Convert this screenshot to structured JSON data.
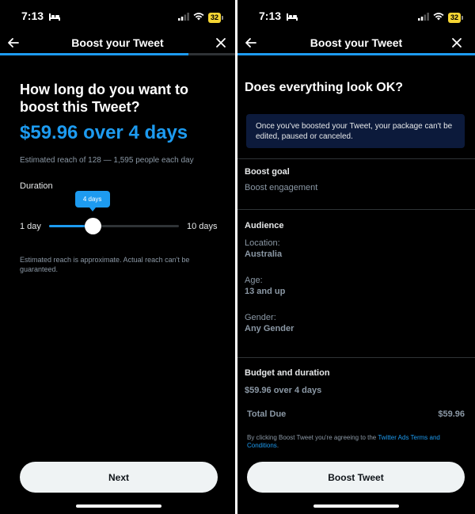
{
  "status_bar": {
    "time": "7:13",
    "battery": "32"
  },
  "left": {
    "nav_title": "Boost your Tweet",
    "question": "How long do you want to boost this Tweet?",
    "price": "$59.96 over 4 days",
    "estimated_reach": "Estimated reach of 128 — 1,595 people each day",
    "duration_label": "Duration",
    "slider": {
      "min_label": "1 day",
      "max_label": "10 days",
      "tooltip": "4 days",
      "value": 4,
      "min": 1,
      "max": 10
    },
    "disclaimer": "Estimated reach is approximate. Actual reach can't be guaranteed.",
    "next_label": "Next",
    "progress": 0.8
  },
  "right": {
    "nav_title": "Boost your Tweet",
    "heading": "Does everything look OK?",
    "warning": "Once you've boosted your Tweet, your package can't be edited, paused or canceled.",
    "boost_goal": {
      "title": "Boost goal",
      "value": "Boost engagement"
    },
    "audience": {
      "title": "Audience",
      "location_label": "Location:",
      "location_value": "Australia",
      "age_label": "Age:",
      "age_value": "13 and up",
      "gender_label": "Gender:",
      "gender_value": "Any Gender"
    },
    "budget": {
      "title": "Budget and duration",
      "value": "$59.96 over 4 days"
    },
    "total_label": "Total Due",
    "total_amount": "$59.96",
    "terms_prefix": "By clicking Boost Tweet you're agreeing to the ",
    "terms_link": "Twitter Ads Terms and Conditions",
    "terms_suffix": ".",
    "boost_label": "Boost Tweet",
    "progress": 1.0
  },
  "colors": {
    "accent": "#1d9bf0",
    "background": "#000000",
    "warning_bg": "#0c1a3b",
    "battery": "#f5d533"
  },
  "icons": {
    "back": "arrow-left-icon",
    "close": "close-icon",
    "wifi": "wifi-icon",
    "signal": "cellular-signal-icon",
    "sleep": "bed-icon"
  }
}
